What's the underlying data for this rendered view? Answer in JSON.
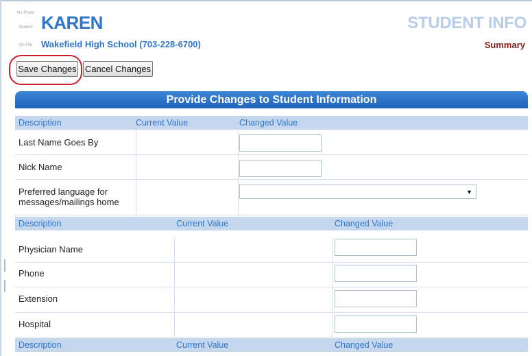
{
  "header": {
    "photo_lines": [
      "No Photo",
      "Student",
      "On File"
    ],
    "student_name": "KAREN",
    "school": "Wakefield High School (703-228-6700)",
    "page_title": "STUDENT INFO",
    "summary_link": "Summary"
  },
  "toolbar": {
    "save_label": "Save Changes",
    "cancel_label": "Cancel Changes"
  },
  "panel": {
    "title": "Provide Changes to Student Information",
    "columns": {
      "description": "Description",
      "current_value": "Current Value",
      "changed_value": "Changed Value"
    },
    "section1": [
      {
        "label": "Last Name Goes By",
        "current": "",
        "changed": ""
      },
      {
        "label": "Nick Name",
        "current": "",
        "changed": ""
      },
      {
        "label": "Preferred language for messages/mailings home",
        "current": "",
        "changed": ""
      }
    ],
    "section2": [
      {
        "label": "Physician Name",
        "current": "",
        "changed": ""
      },
      {
        "label": "Phone",
        "current": "",
        "changed": ""
      },
      {
        "label": "Extension",
        "current": "",
        "changed": ""
      },
      {
        "label": "Hospital",
        "current": "",
        "changed": ""
      }
    ]
  },
  "colors": {
    "accent_blue": "#2f76c8",
    "header_blue": "#1f63b8",
    "column_header_bg": "#c4d7ee",
    "summary_red": "#8a1a1a",
    "highlight_red": "#c8202a"
  }
}
